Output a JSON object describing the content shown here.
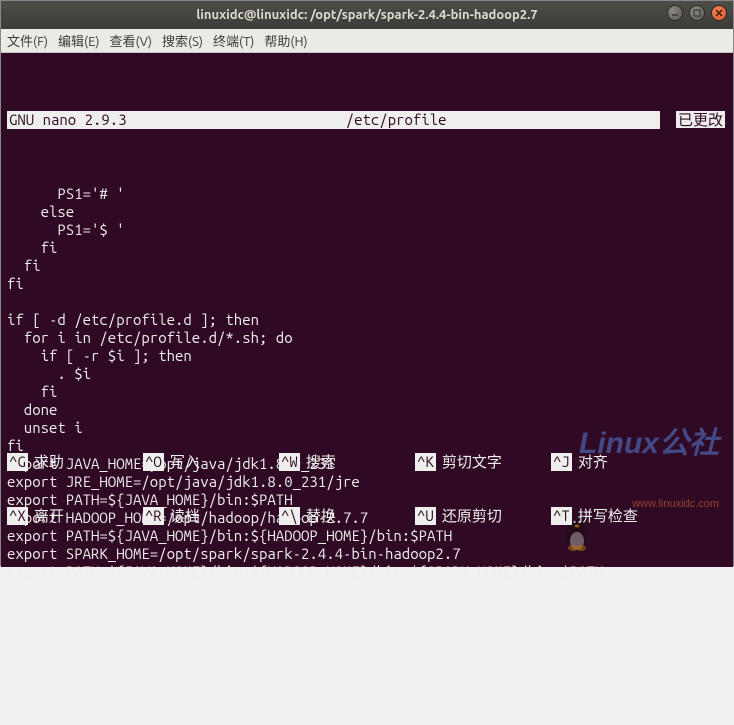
{
  "window": {
    "title": "linuxidc@linuxidc: /opt/spark/spark-2.4.4-bin-hadoop2.7"
  },
  "menubar": {
    "items": [
      "文件(F)",
      "编辑(E)",
      "查看(V)",
      "搜索(S)",
      "终端(T)",
      "帮助(H)"
    ]
  },
  "nano": {
    "version": "GNU nano 2.9.3",
    "filename": "/etc/profile",
    "status": "已更改"
  },
  "content": "      PS1='# '\n    else\n      PS1='$ '\n    fi\n  fi\nfi\n\nif [ -d /etc/profile.d ]; then\n  for i in /etc/profile.d/*.sh; do\n    if [ -r $i ]; then\n      . $i\n    fi\n  done\n  unset i\nfi\nexport JAVA_HOME=/opt/java/jdk1.8.0_231\nexport JRE_HOME=/opt/java/jdk1.8.0_231/jre\nexport PATH=${JAVA_HOME}/bin:$PATH\nexport HADOOP_HOME=/opt/hadoop/hadoop-2.7.7\nexport PATH=${JAVA_HOME}/bin:${HADOOP_HOME}/bin:$PATH\nexport SPARK_HOME=/opt/spark/spark-2.4.4-bin-hadoop2.7\nexport PATH=${JAVA_HOME}/bin:${HADOOP_HOME}/bin:${SPARK_HOME}/bin:$PATH\n",
  "shortcuts": {
    "row1": [
      {
        "key": "^G",
        "label": "求助"
      },
      {
        "key": "^O",
        "label": "写入"
      },
      {
        "key": "^W",
        "label": "搜索"
      },
      {
        "key": "^K",
        "label": "剪切文字"
      },
      {
        "key": "^J",
        "label": "对齐"
      }
    ],
    "row2": [
      {
        "key": "^X",
        "label": "离开"
      },
      {
        "key": "^R",
        "label": "读档"
      },
      {
        "key": "^\\",
        "label": "替换"
      },
      {
        "key": "^U",
        "label": "还原剪切"
      },
      {
        "key": "^T",
        "label": "拼写检查"
      }
    ]
  },
  "watermark": {
    "text": "Linux公社",
    "url": "www.linuxidc.com"
  }
}
